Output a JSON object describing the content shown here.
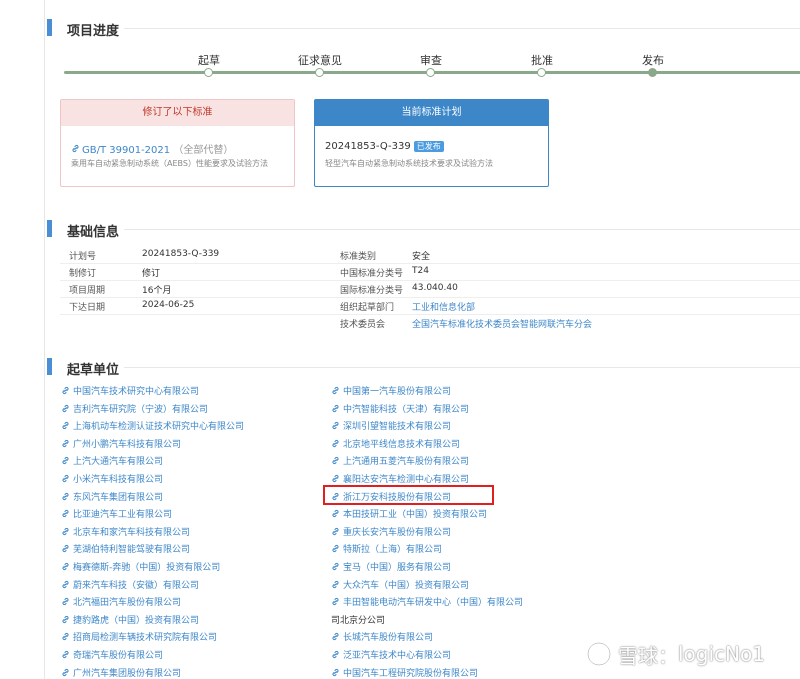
{
  "progress": {
    "title": "项目进度",
    "steps": [
      "起草",
      "征求意见",
      "审查",
      "批准",
      "发布"
    ],
    "active_step": "发布"
  },
  "cards": {
    "previous": {
      "header": "修订了以下标准",
      "code": "GB/T 39901-2021",
      "note": "（全部代替）",
      "desc": "乘用车自动紧急制动系统（AEBS）性能要求及试验方法"
    },
    "current": {
      "header": "当前标准计划",
      "code": "20241853-Q-339",
      "badge": "已发布",
      "desc": "轻型汽车自动紧急制动系统技术要求及试验方法"
    }
  },
  "basic_info": {
    "title": "基础信息",
    "rows": [
      {
        "k1": "计划号",
        "v1": "20241853-Q-339",
        "k2": "标准类别",
        "v2": "安全"
      },
      {
        "k1": "制修订",
        "v1": "修订",
        "k2": "中国标准分类号",
        "v2": "T24"
      },
      {
        "k1": "项目周期",
        "v1": "16个月",
        "k2": "国际标准分类号",
        "v2": "43.040.40"
      },
      {
        "k1": "下达日期",
        "v1": "2024-06-25",
        "k2": "组织起草部门",
        "v2": "工业和信息化部"
      },
      {
        "k1": "",
        "v1": "",
        "k2": "技术委员会",
        "v2": "全国汽车标准化技术委员会智能网联汽车分会"
      }
    ]
  },
  "drafting_units": {
    "title": "起草单位",
    "left": [
      "中国汽车技术研究中心有限公司",
      "吉利汽车研究院（宁波）有限公司",
      "上海机动车检测认证技术研究中心有限公司",
      "广州小鹏汽车科技有限公司",
      "上汽大通汽车有限公司",
      "小米汽车科技有限公司",
      "东风汽车集团有限公司",
      "比亚迪汽车工业有限公司",
      "北京车和家汽车科技有限公司",
      "芜湖伯特利智能驾驶有限公司",
      "梅赛德斯-奔驰（中国）投资有限公司",
      "蔚来汽车科技（安徽）有限公司",
      "北汽福田汽车股份有限公司",
      "捷豹路虎（中国）投资有限公司",
      "招商局检测车辆技术研究院有限公司",
      "奇瑞汽车股份有限公司",
      "广州汽车集团股份有限公司"
    ],
    "right": [
      "中国第一汽车股份有限公司",
      "中汽智能科技（天津）有限公司",
      "深圳引望智能技术有限公司",
      "北京地平线信息技术有限公司",
      "上汽通用五菱汽车股份有限公司",
      "襄阳达安汽车检测中心有限公司",
      "浙江万安科技股份有限公司",
      "本田技研工业（中国）投资有限公司",
      "重庆长安汽车股份有限公司",
      "特斯拉（上海）有限公司",
      "宝马（中国）服务有限公司",
      "大众汽车（中国）投资有限公司",
      "丰田智能电动汽车研发中心（中国）有限公司",
      "司北京分公司",
      "长城汽车股份有限公司",
      "泛亚汽车技术中心有限公司",
      "中国汽车工程研究院股份有限公司"
    ]
  },
  "watermark": {
    "site": "雪球",
    "sep": "：",
    "user": "logicNo1"
  },
  "colors": {
    "accent": "#3d87c9",
    "section_bar": "#4a8fd4",
    "progress": "#8aa88a",
    "highlight": "#e02020"
  }
}
